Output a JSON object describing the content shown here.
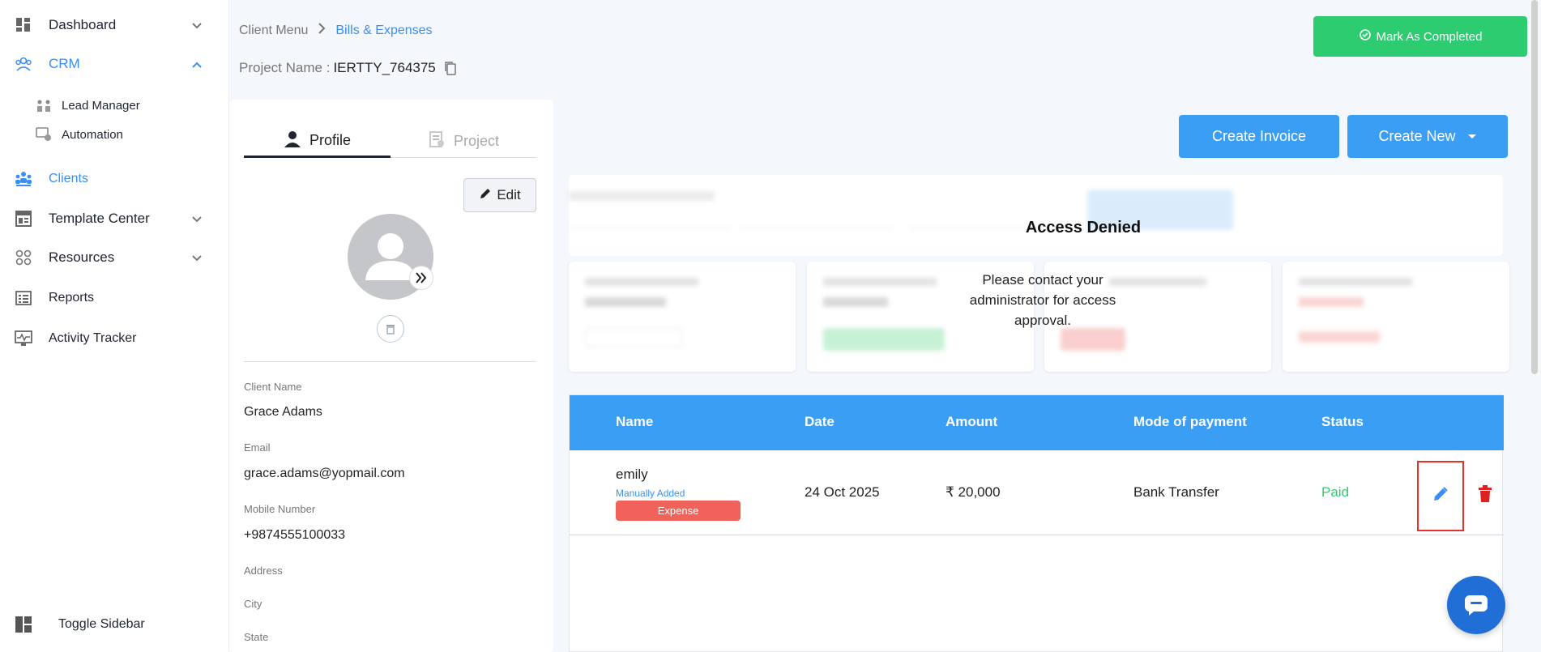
{
  "sidebar": {
    "items": [
      {
        "label": "Dashboard",
        "icon": "dashboard-icon"
      },
      {
        "label": "CRM",
        "icon": "crm-icon"
      },
      {
        "label": "Lead Manager",
        "icon": "lead-manager-icon"
      },
      {
        "label": "Automation",
        "icon": "automation-icon"
      },
      {
        "label": "Clients",
        "icon": "clients-icon"
      },
      {
        "label": "Template Center",
        "icon": "template-icon"
      },
      {
        "label": "Resources",
        "icon": "resources-icon"
      },
      {
        "label": "Reports",
        "icon": "reports-icon"
      },
      {
        "label": "Activity Tracker",
        "icon": "activity-icon"
      }
    ],
    "toggle_label": "Toggle Sidebar"
  },
  "header": {
    "breadcrumb_root": "Client Menu",
    "breadcrumb_current": "Bills & Expenses",
    "project_label": "Project Name :",
    "project_value": "IERTTY_764375",
    "mark_completed": "Mark As Completed"
  },
  "profile": {
    "tab_profile": "Profile",
    "tab_project": "Project",
    "edit_label": "Edit",
    "fields": {
      "client_name_label": "Client Name",
      "client_name": "Grace Adams",
      "email_label": "Email",
      "email": "grace.adams@yopmail.com",
      "mobile_label": "Mobile Number",
      "mobile": "+9874555100033",
      "address_label": "Address",
      "city_label": "City",
      "state_label": "State"
    }
  },
  "actions": {
    "create_invoice": "Create Invoice",
    "create_new": "Create New"
  },
  "access": {
    "title": "Access Denied",
    "message": "Please contact your administrator for access approval."
  },
  "table": {
    "columns": [
      "Name",
      "Date",
      "Amount",
      "Mode of payment",
      "Status"
    ],
    "rows": [
      {
        "name": "emily",
        "source": "Manually Added",
        "type": "Expense",
        "date": "24 Oct 2025",
        "amount": "₹ 20,000",
        "mode": "Bank Transfer",
        "status": "Paid"
      }
    ]
  },
  "colors": {
    "accent": "#3a9ef4",
    "success": "#2ecc71",
    "danger": "#f0625a"
  }
}
